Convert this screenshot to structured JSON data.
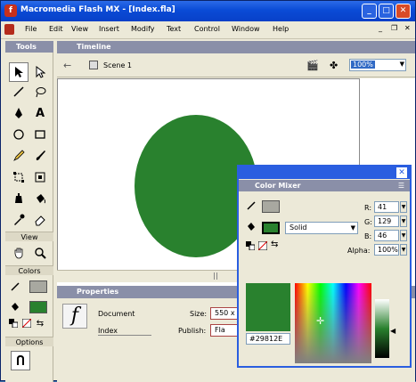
{
  "window": {
    "title": "Macromedia Flash MX - [Index.fla]"
  },
  "menu": {
    "items": [
      "File",
      "Edit",
      "View",
      "Insert",
      "Modify",
      "Text",
      "Control",
      "Window",
      "Help"
    ]
  },
  "tools_panel": {
    "title": "Tools",
    "view_label": "View",
    "colors_label": "Colors",
    "options_label": "Options"
  },
  "timeline": {
    "title": "Timeline"
  },
  "editbar": {
    "scene": "Scene 1",
    "zoom": "100%"
  },
  "properties": {
    "title": "Properties",
    "doc_type": "Document",
    "doc_name": "Index",
    "size_label": "Size:",
    "size_value": "550 x",
    "publish_label": "Publish:",
    "publish_value": "Fla"
  },
  "stage": {
    "shape_color": "#29812E"
  },
  "color_mixer": {
    "title": "Color Mixer",
    "fill_style": "Solid",
    "r_label": "R:",
    "r_value": "41",
    "g_label": "G:",
    "g_value": "129",
    "b_label": "B:",
    "b_value": "46",
    "alpha_label": "Alpha:",
    "alpha_value": "100%",
    "hex": "#29812E"
  }
}
